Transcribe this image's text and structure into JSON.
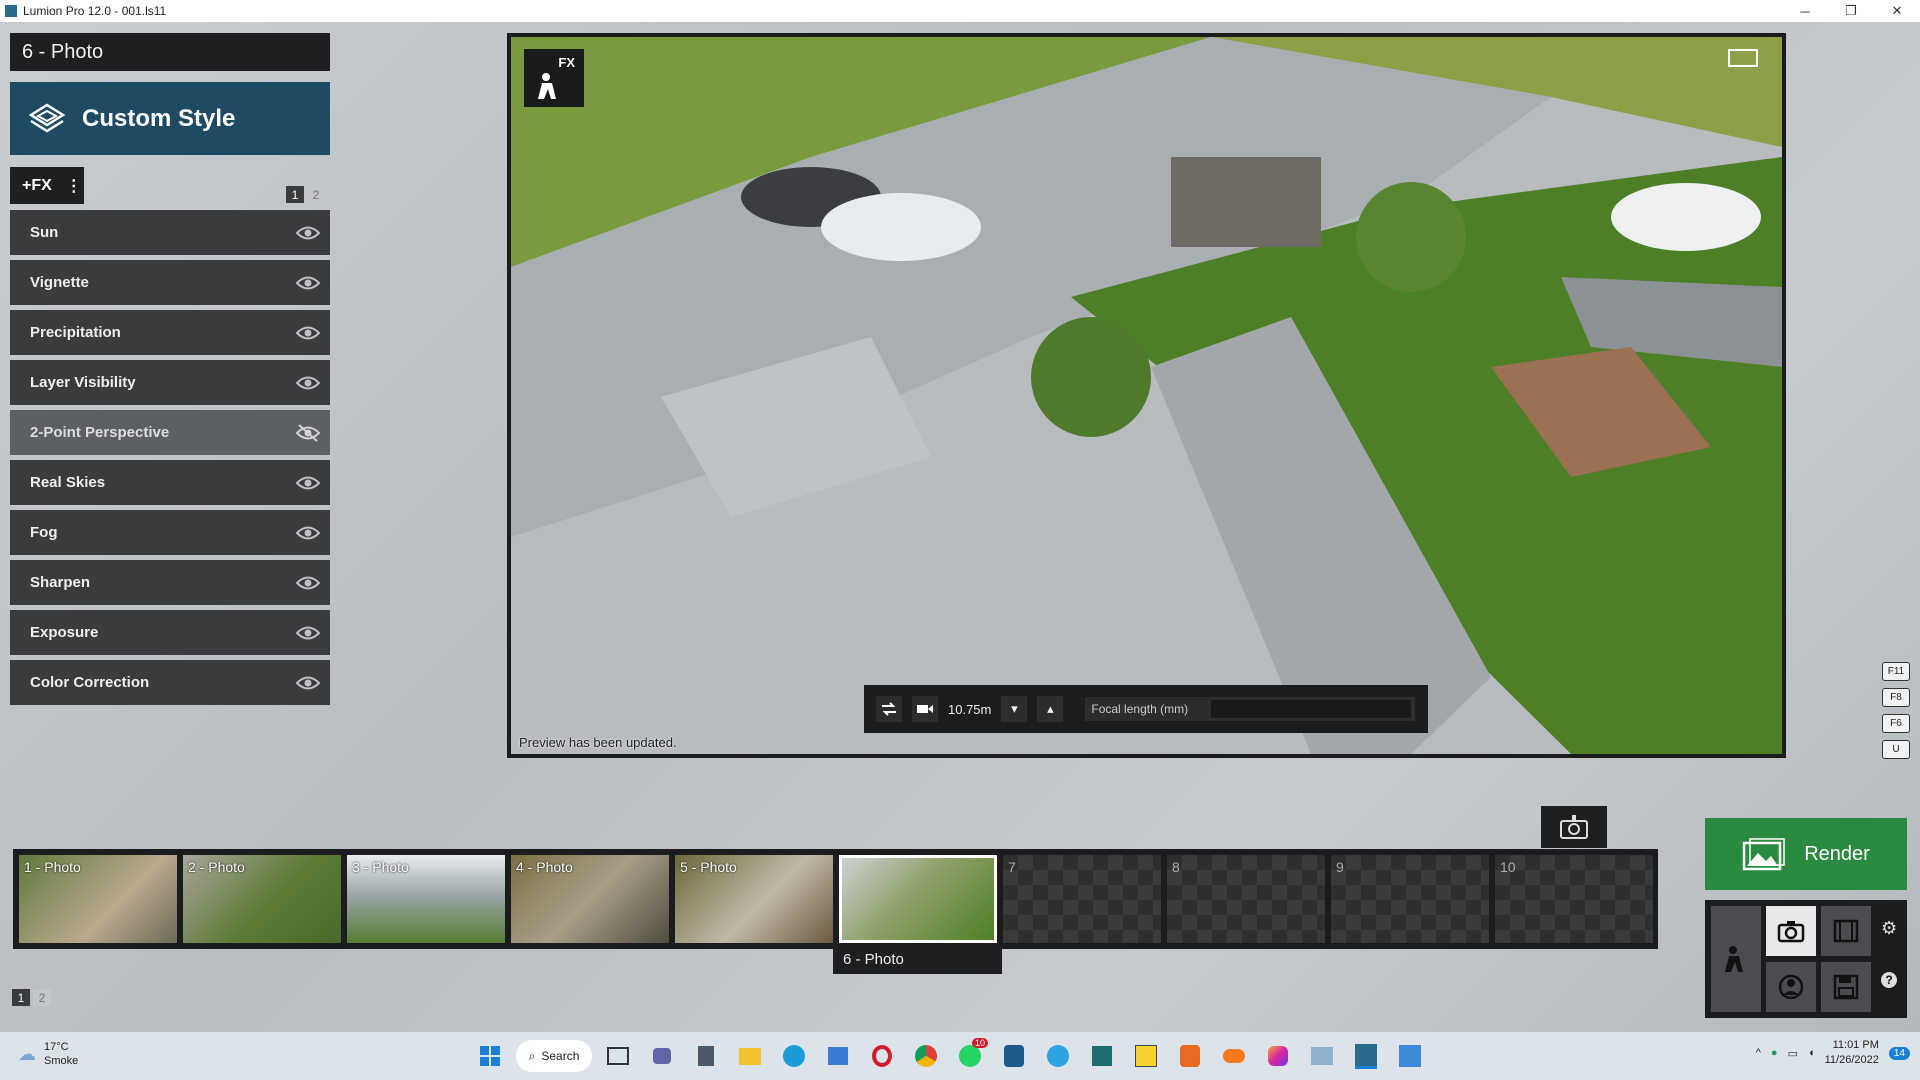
{
  "window": {
    "title": "Lumion Pro 12.0  - 001.ls11",
    "minimize": "─",
    "maximize": "❐",
    "close": "✕"
  },
  "left": {
    "mode_title": "6 - Photo",
    "style_label": "Custom Style",
    "fx_add": "+FX",
    "fx_menu": "⋮",
    "pages": [
      "1",
      "2"
    ],
    "effects": [
      {
        "label": "Sun"
      },
      {
        "label": "Vignette"
      },
      {
        "label": "Precipitation"
      },
      {
        "label": "Layer Visibility"
      },
      {
        "label": "2-Point Perspective"
      },
      {
        "label": "Real Skies"
      },
      {
        "label": "Fog"
      },
      {
        "label": "Sharpen"
      },
      {
        "label": "Exposure"
      },
      {
        "label": "Color Correction"
      }
    ]
  },
  "viewport": {
    "fx_badge": "FX",
    "preview_status": "Preview has been updated.",
    "camera": {
      "height_value": "10.75m",
      "focal_label": "Focal length (mm)"
    }
  },
  "shortcut_keys": [
    "F11",
    "F8",
    "F6",
    "U"
  ],
  "photoset": {
    "thumbnails": [
      {
        "label": "1 - Photo"
      },
      {
        "label": "2 - Photo"
      },
      {
        "label": "3 - Photo"
      },
      {
        "label": "4 - Photo"
      },
      {
        "label": "5 - Photo"
      },
      {
        "label": ""
      },
      {
        "label": "7"
      },
      {
        "label": "8"
      },
      {
        "label": "9"
      },
      {
        "label": "10"
      }
    ],
    "selected_label": "6 - Photo",
    "pages": [
      "1",
      "2"
    ]
  },
  "render_label": "Render",
  "taskbar": {
    "temperature": "17°C",
    "condition": "Smoke",
    "search_label": "Search",
    "whatsapp_badge": "10",
    "time": "11:01 PM",
    "date": "11/26/2022",
    "notification_count": "14"
  },
  "colors": {
    "accent_style": "#1f4a63",
    "render_green": "#2a8a3f",
    "panel_dark": "#393b3d"
  }
}
